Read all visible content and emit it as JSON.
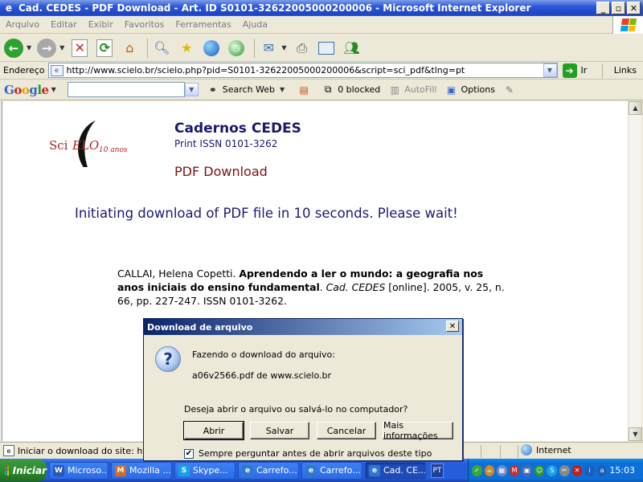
{
  "window": {
    "title": "Cad. CEDES - PDF Download - Art. ID S0101-32622005000200006 - Microsoft Internet Explorer",
    "minimize": "_",
    "maximize": "▫",
    "close": "✕"
  },
  "menu": {
    "items": [
      "Arquivo",
      "Editar",
      "Exibir",
      "Favoritos",
      "Ferramentas",
      "Ajuda"
    ]
  },
  "toolbar": {
    "icons": [
      "back-icon",
      "forward-icon",
      "stop-icon",
      "refresh-icon",
      "home-icon",
      "search-icon",
      "favorites-icon",
      "media-icon",
      "history-icon",
      "mail-icon",
      "print-icon",
      "edit-icon",
      "messenger-icon"
    ]
  },
  "address": {
    "label": "Endereço",
    "url": "http://www.scielo.br/scielo.php?pid=S0101-32622005000200006&script=sci_pdf&tlng=pt",
    "go_label": "Ir",
    "links_label": "Links"
  },
  "googlebar": {
    "logo": "Google",
    "search_web": "Search Web",
    "blocked": "0 blocked",
    "autofill": "AutoFill",
    "options": "Options"
  },
  "page": {
    "logo_sci": "Sci",
    "logo_elo": "ELO",
    "logo_anos": "10 anos",
    "journal_title": "Cadernos CEDES",
    "issn": "Print ISSN 0101-3262",
    "pdf_heading": "PDF Download",
    "initiating": "Initiating download of PDF file in 10 seconds. Please wait!",
    "citation": {
      "authors": "CALLAI, Helena Copetti.",
      "title": "Aprendendo a ler o mundo: a geografia nos anos iniciais do ensino fundamental",
      "journal": "Cad. CEDES",
      "online": " [online]. 2005, v. 25, n. 66, pp. 227-247. ISSN 0101-3262."
    }
  },
  "dialog": {
    "title": "Download de arquivo",
    "close": "✕",
    "line1": "Fazendo o download do arquivo:",
    "filename": "a06v2566.pdf de www.scielo.br",
    "question": "Deseja abrir o arquivo ou salvá-lo no computador?",
    "buttons": {
      "open": "Abrir",
      "save": "Salvar",
      "cancel": "Cancelar",
      "more": "Mais informações"
    },
    "checkbox_label": "Sempre perguntar antes de abrir arquivos deste tipo",
    "checkbox_checked": true
  },
  "status": {
    "text": "Iniciar o download do site: http:/",
    "zone": "Internet"
  },
  "taskbar": {
    "start": "Iniciar",
    "tasks": [
      {
        "label": "Microso...",
        "icon": "W",
        "color": "#2b57b8"
      },
      {
        "label": "Mozilla ...",
        "icon": "M",
        "color": "#d96a1c"
      },
      {
        "label": "Skype...",
        "icon": "S",
        "color": "#1aa0e6"
      },
      {
        "label": "Carrefo...",
        "icon": "e",
        "color": "#2f78d0"
      },
      {
        "label": "Carrefo...",
        "icon": "e",
        "color": "#2f78d0"
      },
      {
        "label": "Cad. CE...",
        "icon": "e",
        "color": "#2f78d0"
      }
    ],
    "active_index": 5,
    "lang": "PT",
    "clock": "15:03"
  }
}
